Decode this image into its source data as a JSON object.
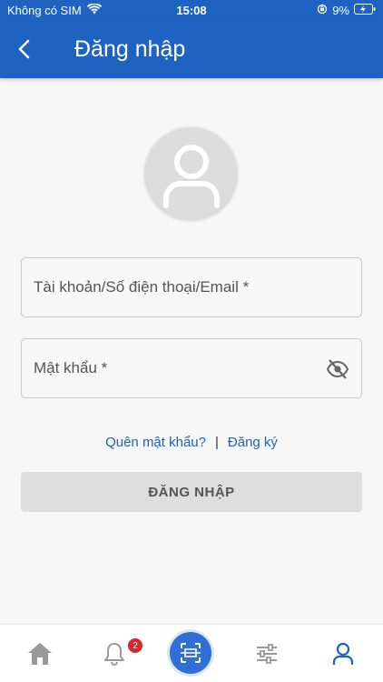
{
  "status_bar": {
    "carrier": "Không có SIM",
    "time": "15:08",
    "battery": "9%"
  },
  "header": {
    "title": "Đăng nhập"
  },
  "form": {
    "username_placeholder": "Tài khoản/Số điện thoại/Email *",
    "password_placeholder": "Mật khẩu *"
  },
  "links": {
    "forgot_password": "Quên mật khẩu?",
    "separator": "|",
    "register": "Đăng ký"
  },
  "login_button": {
    "label": "ĐĂNG NHẬP"
  },
  "bottom_nav": {
    "items": [
      {
        "icon": "home-icon"
      },
      {
        "icon": "bell-icon",
        "badge": "2"
      },
      {
        "icon": "scan-icon"
      },
      {
        "icon": "sliders-icon"
      },
      {
        "icon": "account-icon"
      }
    ]
  },
  "colors": {
    "primary": "#1f63c2",
    "link": "#1f5fc0",
    "badge": "#d9262c",
    "button_disabled": "#dedede"
  }
}
